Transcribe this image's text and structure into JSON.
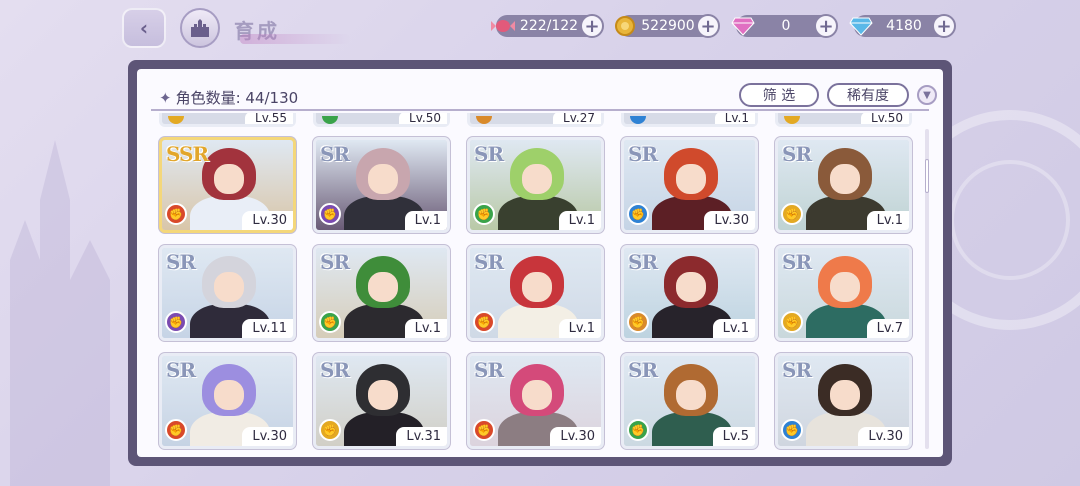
{
  "header": {
    "title": "育成",
    "resources": [
      {
        "name": "candy",
        "icon": "candy-icon",
        "value": "222/122",
        "color": "#e25a7b"
      },
      {
        "name": "coin",
        "icon": "coin-icon",
        "value": "522900",
        "color": "#e8b53a"
      },
      {
        "name": "pink-gem",
        "icon": "pink-gem-icon",
        "value": "0",
        "color": "#e06fc2"
      },
      {
        "name": "blue-gem",
        "icon": "blue-gem-icon",
        "value": "4180",
        "color": "#5ab8e8"
      }
    ]
  },
  "panel": {
    "count_label": "角色数量: 44/130",
    "filter_label": "筛 选",
    "rarity_label": "稀有度"
  },
  "partial_row": [
    {
      "level": "Lv.55",
      "element": "yellow"
    },
    {
      "level": "Lv.50",
      "element": "green"
    },
    {
      "level": "Lv.27",
      "element": "orange"
    },
    {
      "level": "Lv.1",
      "element": "blue"
    },
    {
      "level": "Lv.50",
      "element": "yellow"
    }
  ],
  "cards": [
    {
      "rarity": "SSR",
      "level": "Lv.30",
      "element": "fire",
      "hair": "#a2333d",
      "outfit": "#e9eef7",
      "scene": "#d9c6a9"
    },
    {
      "rarity": "SR",
      "level": "Lv.1",
      "element": "purple",
      "hair": "#c8a6ae",
      "outfit": "#30303a",
      "scene": "#6a5b76"
    },
    {
      "rarity": "SR",
      "level": "Lv.1",
      "element": "green",
      "hair": "#9ed06a",
      "outfit": "#39402f",
      "scene": "#b9c9a7"
    },
    {
      "rarity": "SR",
      "level": "Lv.30",
      "element": "blue",
      "hair": "#d04a2c",
      "outfit": "#5c1f25",
      "scene": "#c5d4e5"
    },
    {
      "rarity": "SR",
      "level": "Lv.1",
      "element": "yellow",
      "hair": "#8a5a3a",
      "outfit": "#3c3a2f",
      "scene": "#bfd3d3"
    },
    {
      "rarity": "SR",
      "level": "Lv.11",
      "element": "purple",
      "hair": "#d4d4dc",
      "outfit": "#2f2b3a",
      "scene": "#c6d4e6"
    },
    {
      "rarity": "SR",
      "level": "Lv.1",
      "element": "green",
      "hair": "#3f8d3a",
      "outfit": "#2c2a2f",
      "scene": "#d6cdb9"
    },
    {
      "rarity": "SR",
      "level": "Lv.1",
      "element": "fire",
      "hair": "#c8353b",
      "outfit": "#f3efe5",
      "scene": "#cfd9e6"
    },
    {
      "rarity": "SR",
      "level": "Lv.1",
      "element": "orange",
      "hair": "#8c2a2d",
      "outfit": "#27232b",
      "scene": "#bdd3e0"
    },
    {
      "rarity": "SR",
      "level": "Lv.7",
      "element": "yellow",
      "hair": "#ef7a4a",
      "outfit": "#2d6c62",
      "scene": "#c9d8dc"
    },
    {
      "rarity": "SR",
      "level": "Lv.30",
      "element": "fire",
      "hair": "#9c8ee0",
      "outfit": "#f1ece4",
      "scene": "#c6d3e4"
    },
    {
      "rarity": "SR",
      "level": "Lv.31",
      "element": "yellow",
      "hair": "#2e2e32",
      "outfit": "#232027",
      "scene": "#d1cfc6"
    },
    {
      "rarity": "SR",
      "level": "Lv.30",
      "element": "fire",
      "hair": "#d44a7a",
      "outfit": "#8c7d82",
      "scene": "#dcd3dd"
    },
    {
      "rarity": "SR",
      "level": "Lv.5",
      "element": "green",
      "hair": "#b06a32",
      "outfit": "#2f5e4f",
      "scene": "#ccd9e2"
    },
    {
      "rarity": "SR",
      "level": "Lv.30",
      "element": "blue",
      "hair": "#3b2c25",
      "outfit": "#e7e3dc",
      "scene": "#d0d6df"
    }
  ],
  "element_colors": {
    "fire": "#d9492a",
    "purple": "#7b4bb0",
    "green": "#3aa34a",
    "blue": "#2f82d4",
    "yellow": "#e3a923",
    "orange": "#d98a2a"
  }
}
